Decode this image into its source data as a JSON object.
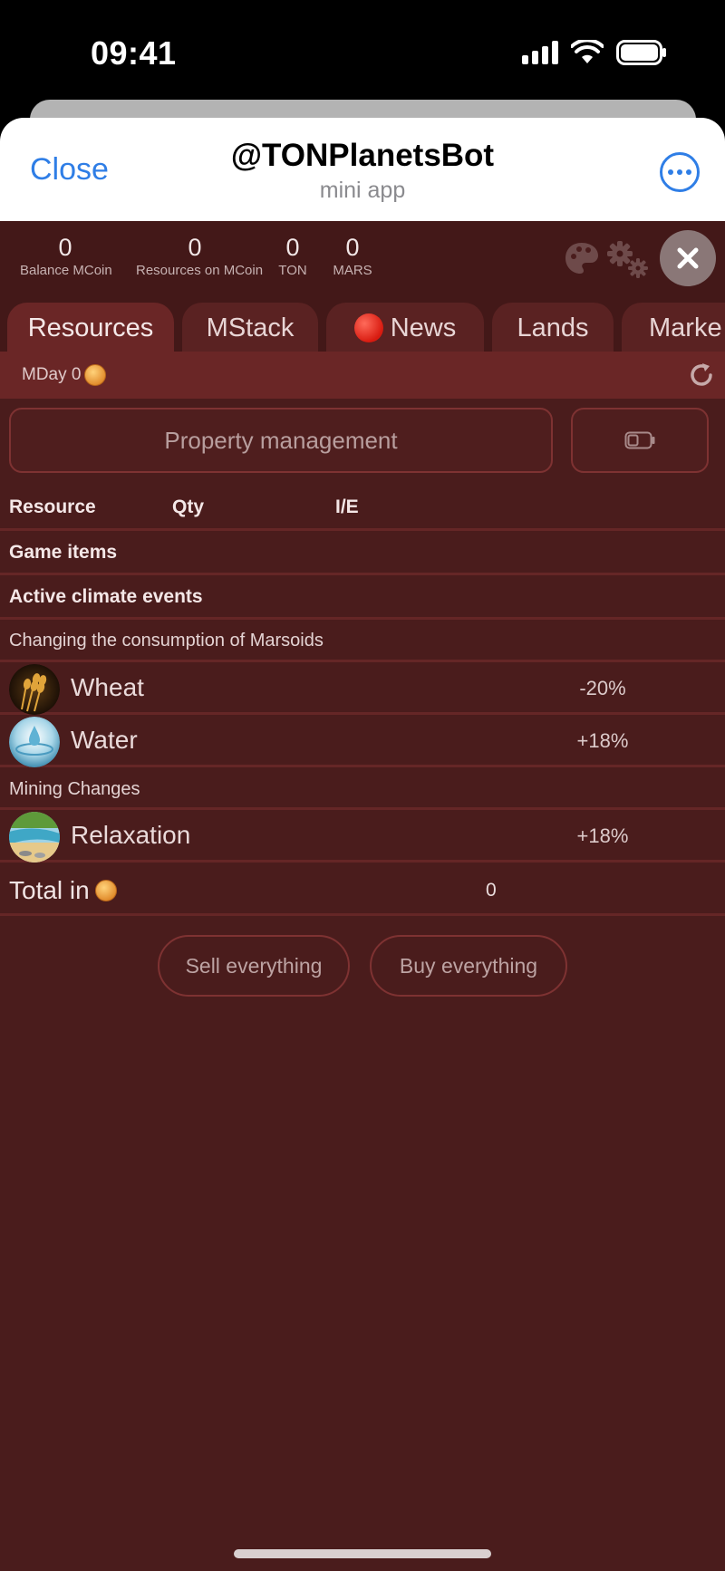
{
  "status_bar": {
    "time": "09:41"
  },
  "telegram_header": {
    "close_label": "Close",
    "title": "@TONPlanetsBot",
    "subtitle": "mini app"
  },
  "stats": [
    {
      "value": "0",
      "label": "Balance MCoin"
    },
    {
      "value": "0",
      "label": "Resources on MCoin"
    },
    {
      "value": "0",
      "label": "TON"
    },
    {
      "value": "0",
      "label": "MARS"
    }
  ],
  "tabs": [
    {
      "label": "Resources",
      "active": true
    },
    {
      "label": "MStack"
    },
    {
      "label": "News"
    },
    {
      "label": "Lands"
    },
    {
      "label": "Marke"
    }
  ],
  "mday": {
    "label": "MDay 0"
  },
  "actions": {
    "property_management": "Property management"
  },
  "table": {
    "headers": {
      "resource": "Resource",
      "qty": "Qty",
      "ie": "I/E"
    },
    "game_items": "Game items",
    "active_climate": "Active climate events",
    "consumption_section": "Changing the consumption of Marsoids",
    "mining_section": "Mining Changes",
    "resources": [
      {
        "name": "Wheat",
        "value": "-20%",
        "icon": "wheat-icon"
      },
      {
        "name": "Water",
        "value": "+18%",
        "icon": "water-icon"
      },
      {
        "name": "Relaxation",
        "value": "+18%",
        "icon": "beach-icon"
      }
    ],
    "total_label": "Total in",
    "total_value": "0"
  },
  "buttons": {
    "sell": "Sell everything",
    "buy": "Buy everything"
  },
  "colors": {
    "background": "#4a1c1c",
    "tab_active": "#6a2626",
    "accent_blue": "#2f7ee6",
    "coin": "#e08a2a"
  }
}
